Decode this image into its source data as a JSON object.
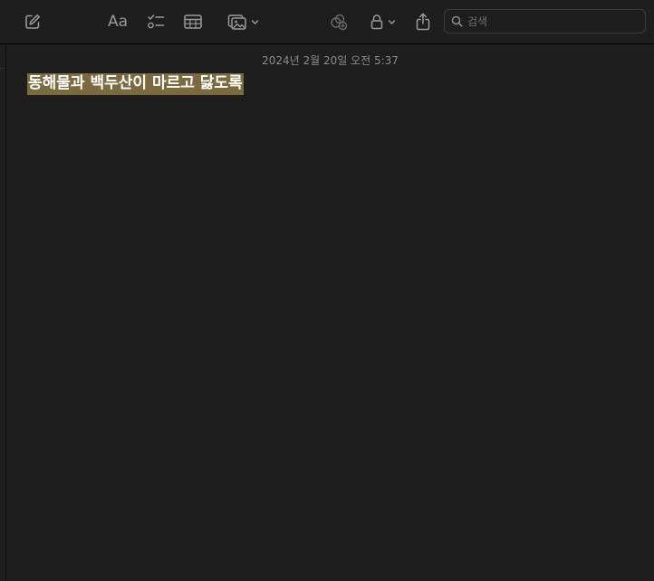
{
  "toolbar": {
    "new_note_icon": "compose-icon",
    "format_icon": "text-format-icon",
    "format_label": "Aa",
    "checklist_icon": "checklist-icon",
    "table_icon": "table-icon",
    "media_icon": "photo-icon",
    "collaborate_icon": "collaborate-icon",
    "lock_icon": "lock-icon",
    "share_icon": "share-icon"
  },
  "search": {
    "placeholder": "검색",
    "value": ""
  },
  "note": {
    "date": "2024년 2월 20일 오전 5:37",
    "title": "동해물과 백두산이 마르고 닳도록"
  },
  "colors": {
    "background": "#1e1e1e",
    "icon": "#9a9a9a",
    "highlight": "#7c6a3f",
    "date_text": "#8c8c8c"
  }
}
